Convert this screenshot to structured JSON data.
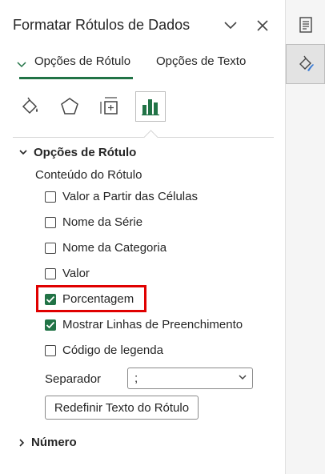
{
  "pane": {
    "title": "Formatar Rótulos de Dados",
    "tabs": [
      {
        "label": "Opções de Rótulo",
        "active": true
      },
      {
        "label": "Opções de Texto",
        "active": false
      }
    ],
    "icon_tabs": [
      "fill-line-icon",
      "effects-pentagon-icon",
      "size-properties-icon",
      "label-options-chart-icon"
    ],
    "section": {
      "title": "Opções de Rótulo",
      "content_label": "Conteúdo do Rótulo",
      "checkboxes": [
        {
          "label": "Valor a Partir das Células",
          "checked": false
        },
        {
          "label": "Nome da Série",
          "checked": false
        },
        {
          "label": "Nome da Categoria",
          "checked": false
        },
        {
          "label": "Valor",
          "checked": false
        },
        {
          "label": "Porcentagem",
          "checked": true
        },
        {
          "label": "Mostrar Linhas de Preenchimento",
          "checked": true
        },
        {
          "label": "Código de legenda",
          "checked": false
        }
      ],
      "separator_label": "Separador",
      "separator_value": ";",
      "reset_button": "Redefinir Texto do Rótulo"
    },
    "collapsed_section": "Número"
  },
  "colors": {
    "accent": "#217346",
    "highlight": "#e00000"
  }
}
